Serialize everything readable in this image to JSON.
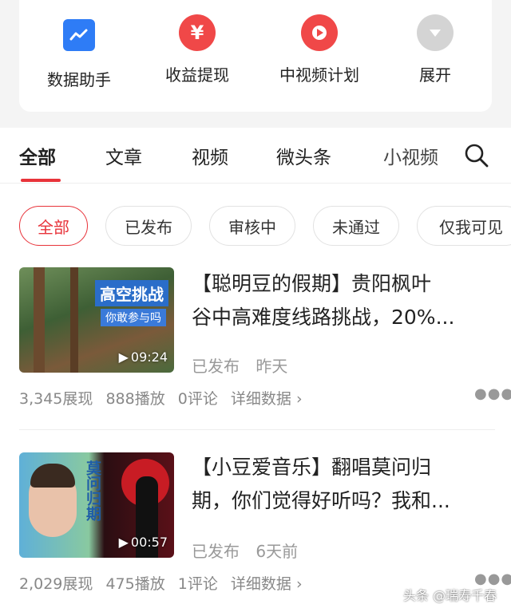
{
  "tools": [
    {
      "label": "数据助手",
      "icon": "chart-icon",
      "color": "#2e7cf6"
    },
    {
      "label": "收益提现",
      "icon": "yen-icon",
      "color": "#f04848"
    },
    {
      "label": "中视频计划",
      "icon": "play-icon",
      "color": "#f04848"
    },
    {
      "label": "展开",
      "icon": "chevron-down-icon",
      "color": "#cccccc"
    }
  ],
  "tabs": [
    "全部",
    "文章",
    "视频",
    "微头条",
    "小视频"
  ],
  "filters": [
    "全部",
    "已发布",
    "审核中",
    "未通过",
    "仅我可见"
  ],
  "items": [
    {
      "title_line1": "【聪明豆的假期】贵阳枫叶",
      "title_line2": "谷中高难度线路挑战，20%...",
      "status": "已发布",
      "time": "昨天",
      "duration": "09:24",
      "thumb_text1": "高空挑战",
      "thumb_text2": "你敢参与吗",
      "stats": {
        "views": "3,345展现",
        "plays": "888播放",
        "comments": "0评论",
        "detail": "详细数据"
      }
    },
    {
      "title_line1": "【小豆爱音乐】翻唱莫问归",
      "title_line2": "期，你们觉得好听吗？我和...",
      "status": "已发布",
      "time": "6天前",
      "duration": "00:57",
      "thumb_text1": "莫问归期",
      "stats": {
        "views": "2,029展现",
        "plays": "475播放",
        "comments": "1评论",
        "detail": "详细数据"
      }
    }
  ],
  "watermark": "头条 @瑞寿千春",
  "accent": "#e8333a"
}
